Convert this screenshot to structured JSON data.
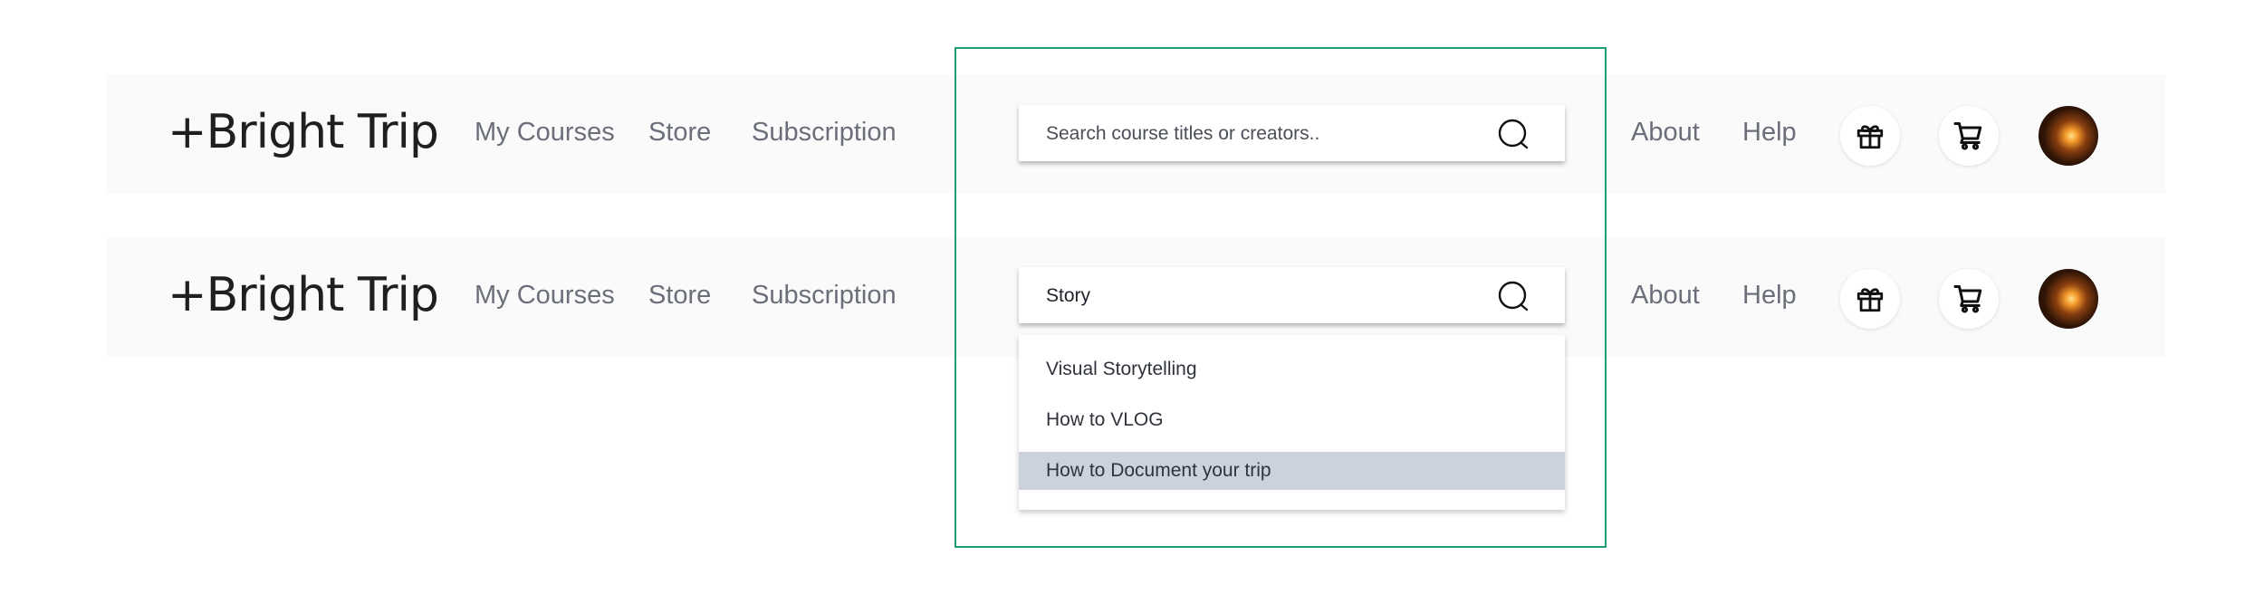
{
  "navbars": [
    {
      "logo": "+Bright Trip",
      "links": {
        "my_courses": "My Courses",
        "store": "Store",
        "subscription": "Subscription",
        "about": "About",
        "help": "Help"
      },
      "search": {
        "placeholder": "Search course titles or creators.."
      }
    },
    {
      "logo": "+Bright Trip",
      "links": {
        "my_courses": "My Courses",
        "store": "Store",
        "subscription": "Subscription",
        "about": "About",
        "help": "Help"
      },
      "search": {
        "value": "Story"
      },
      "suggestions": [
        "Visual Storytelling",
        "How to VLOG",
        "How to Document your trip"
      ],
      "highlighted_suggestion": "How to Document your trip"
    }
  ],
  "icons": [
    "gift-icon",
    "cart-icon",
    "search-icon"
  ],
  "colors": {
    "frame": "#1f9c78",
    "highlight_row": "#ccd2dc",
    "navbar_bg": "#fafafa"
  }
}
